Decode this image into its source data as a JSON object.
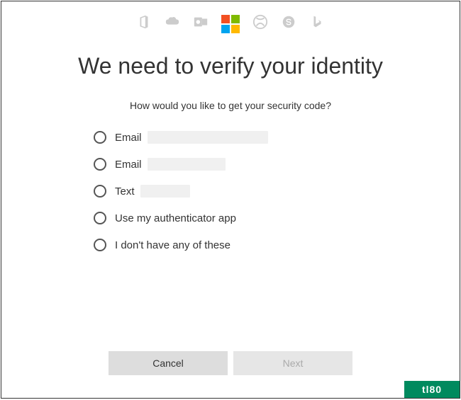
{
  "icons": {
    "office": "office-icon",
    "onedrive": "onedrive-icon",
    "outlook": "outlook-icon",
    "microsoft": "microsoft-logo",
    "xbox": "xbox-icon",
    "skype": "skype-icon",
    "bing": "bing-icon"
  },
  "header": {
    "title": "We need to verify your identity"
  },
  "prompt": {
    "text": "How would you like to get your security code?"
  },
  "options": [
    {
      "label": "Email",
      "redacted": true,
      "redactWidth": "w1"
    },
    {
      "label": "Email",
      "redacted": true,
      "redactWidth": "w2"
    },
    {
      "label": "Text",
      "redacted": true,
      "redactWidth": "w3"
    },
    {
      "label": "Use my authenticator app",
      "redacted": false
    },
    {
      "label": "I don't have any of these",
      "redacted": false
    }
  ],
  "buttons": {
    "cancel": "Cancel",
    "next": "Next"
  },
  "watermark": {
    "text": "tl80"
  }
}
